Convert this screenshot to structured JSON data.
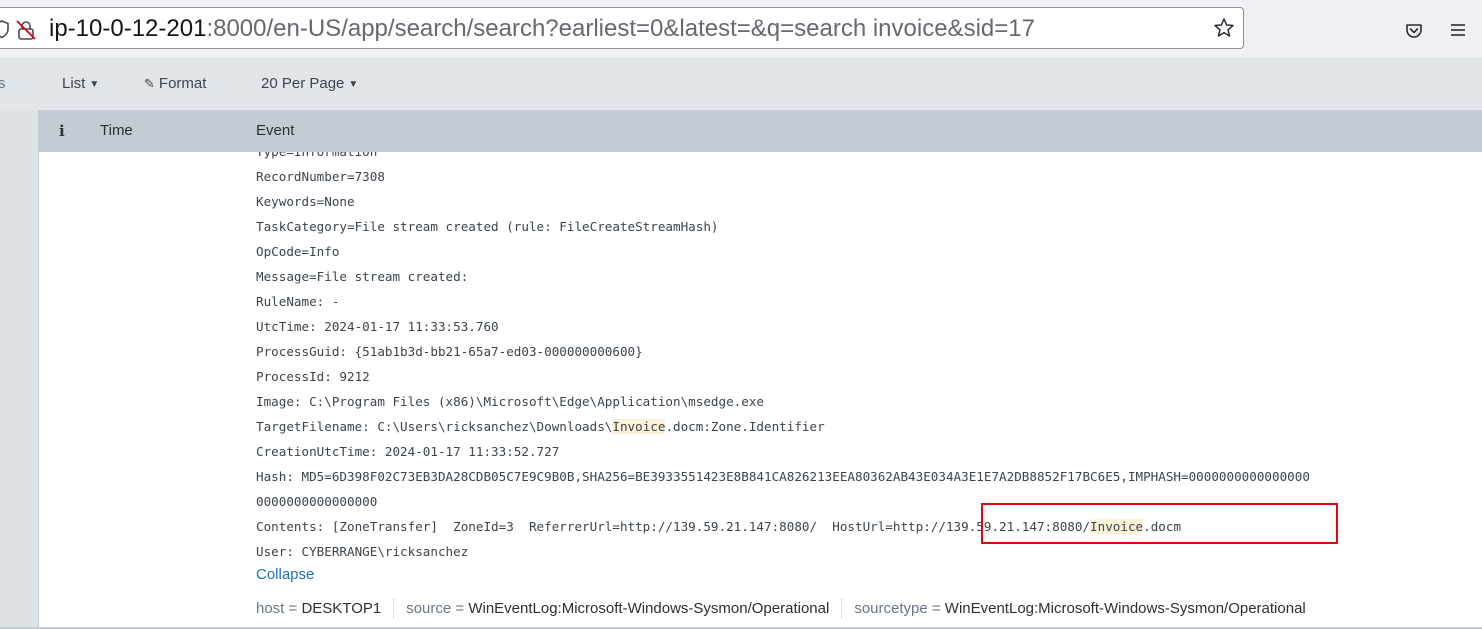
{
  "browser": {
    "url_host": "ip-10-0-12-201",
    "url_rest": ":8000/en-US/app/search/search?earliest=0&latest=&q=search invoice&sid=17"
  },
  "toolbar": {
    "left_stub": "s",
    "list_label": "List",
    "format_label": "Format",
    "per_page_label": "20 Per Page"
  },
  "table": {
    "info_col": "i",
    "time_col": "Time",
    "event_col": "Event"
  },
  "event": {
    "lines": [
      "Type=Information",
      "RecordNumber=7308",
      "Keywords=None",
      "TaskCategory=File stream created (rule: FileCreateStreamHash)",
      "OpCode=Info",
      "Message=File stream created:",
      "RuleName: -",
      "UtcTime: 2024-01-17 11:33:53.760",
      "ProcessGuid: {51ab1b3d-bb21-65a7-ed03-000000000600}",
      "ProcessId: 9212",
      "Image: C:\\Program Files (x86)\\Microsoft\\Edge\\Application\\msedge.exe"
    ],
    "target_prefix": "TargetFilename: C:\\Users\\ricksanchez\\Downloads\\",
    "target_highlight": "Invoice",
    "target_suffix": ".docm:Zone.Identifier",
    "creation_time": "CreationUtcTime: 2024-01-17 11:33:52.727",
    "hash_line1": "Hash: MD5=6D398F02C73EB3DA28CDB05C7E9C9B0B,SHA256=BE3933551423E8B841CA826213EEA80362AB43E034A3E1E7A2DB8852F17BC6E5,IMPHASH=0000000000000000",
    "hash_line2": "0000000000000000",
    "contents_prefix": "Contents: [ZoneTransfer]  ZoneId=3  ReferrerUrl=http://139.59.21.147:8080/  HostUrl=http://139.59.21.147:8080/",
    "contents_highlight": "Invoice",
    "contents_suffix": ".docm",
    "user_line": "User: CYBERRANGE\\ricksanchez",
    "collapse_label": "Collapse"
  },
  "meta": {
    "host_key": "host = ",
    "host_val": "DESKTOP1",
    "source_key": "source = ",
    "source_val": "WinEventLog:Microsoft-Windows-Sysmon/Operational",
    "sourcetype_key": "sourcetype = ",
    "sourcetype_val": "WinEventLog:Microsoft-Windows-Sysmon/Operational"
  },
  "colors": {
    "highlight": "#fdf1d7",
    "annotation_box": "#e30613",
    "link": "#1a73b5"
  }
}
